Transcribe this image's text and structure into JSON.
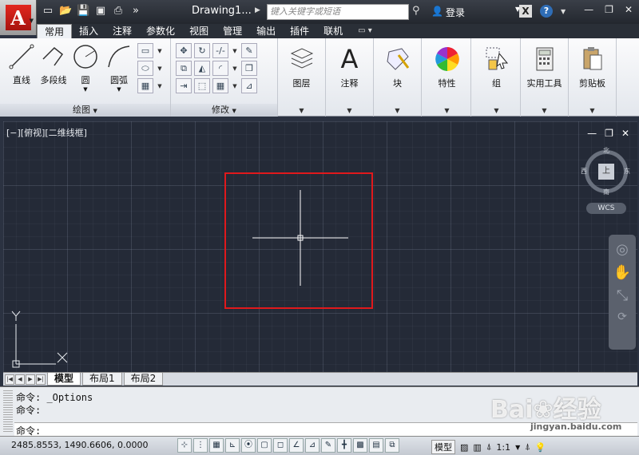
{
  "titlebar": {
    "doc_title": "Drawing1...",
    "search_placeholder": "键入关键字或短语",
    "login": "登录"
  },
  "ribbon_tabs": [
    "常用",
    "插入",
    "注释",
    "参数化",
    "视图",
    "管理",
    "输出",
    "插件",
    "联机"
  ],
  "draw_panel": {
    "title": "绘图",
    "tools": [
      "直线",
      "多段线",
      "圆",
      "圆弧"
    ]
  },
  "modify_panel": {
    "title": "修改"
  },
  "big_panels": [
    "图层",
    "注释",
    "块",
    "特性",
    "组",
    "实用工具",
    "剪贴板"
  ],
  "viewport": {
    "label": "[−][俯视][二维线框]",
    "viewcube": {
      "n": "北",
      "s": "南",
      "e": "东",
      "w": "西",
      "face": "上"
    },
    "wcs": "WCS"
  },
  "layout_tabs": [
    "模型",
    "布局1",
    "布局2"
  ],
  "command": {
    "lines": [
      "命令: _Options",
      "命令:"
    ],
    "prompt": "命令:"
  },
  "status": {
    "coords": "2485.8553, 1490.6606, 0.0000",
    "model": "模型",
    "scale": "1:1"
  },
  "colors": {
    "selection_box": "#e0191c",
    "canvas": "#242a37",
    "brand": "#e2271f"
  }
}
